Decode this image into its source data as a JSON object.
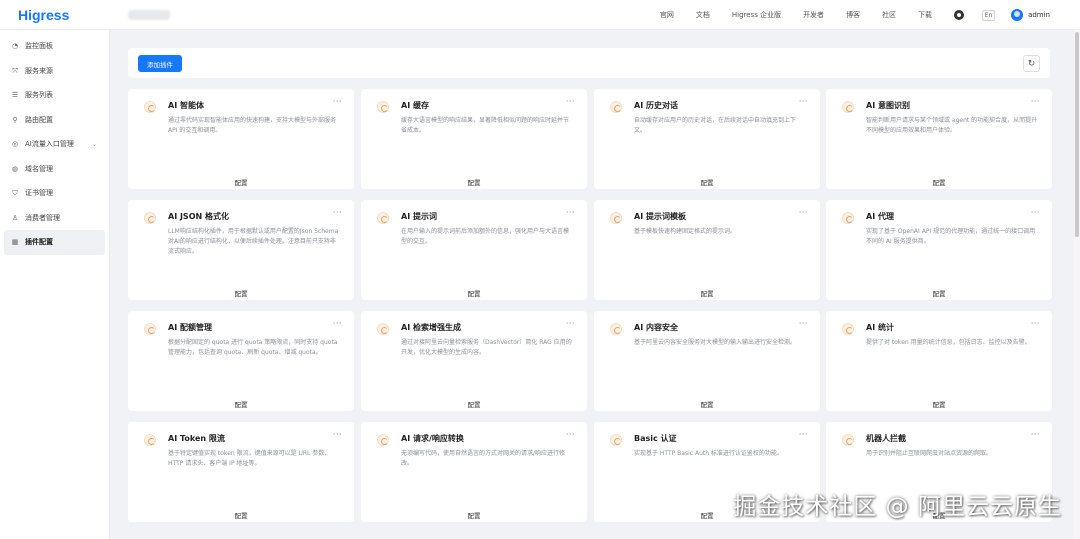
{
  "header": {
    "logo": "Higress",
    "nav": [
      "官网",
      "文档",
      "Higress 企业版",
      "开发者",
      "博客",
      "社区",
      "下载"
    ],
    "lang": "En",
    "user": "admin"
  },
  "sidebar": {
    "items": [
      {
        "label": "监控面板",
        "icon": "dashboard-icon"
      },
      {
        "label": "服务来源",
        "icon": "source-icon"
      },
      {
        "label": "服务列表",
        "icon": "list-icon"
      },
      {
        "label": "路由配置",
        "icon": "route-icon"
      },
      {
        "label": "AI流量入口管理",
        "icon": "ai-gateway-icon",
        "has_children": true
      },
      {
        "label": "域名管理",
        "icon": "globe-icon"
      },
      {
        "label": "证书管理",
        "icon": "certificate-icon"
      },
      {
        "label": "消费者管理",
        "icon": "user-icon"
      },
      {
        "label": "插件配置",
        "icon": "plugin-icon",
        "active": true
      }
    ]
  },
  "toolbar": {
    "add_label": "添加插件"
  },
  "card_action": "配置",
  "cards": [
    {
      "title": "AI 智能体",
      "desc": "通过零代码实现智能体应用的快速构建，支持大模型与外部服务 API 的交互和调用。"
    },
    {
      "title": "AI 缓存",
      "desc": "缓存大语言模型的响应结果，显著降低相似问题的响应时延并节省成本。"
    },
    {
      "title": "AI 历史对话",
      "desc": "自动缓存对应用户的历史对话，在后续对话中自动填充到上下文。"
    },
    {
      "title": "AI 意图识别",
      "desc": "智能判断用户请求与某个领域或 agent 的功能契合度，从而提升不同模型的应用效果和用户体验。"
    },
    {
      "title": "AI JSON 格式化",
      "desc": "LLM响应结构化插件，用于根据默认或用户配置的Json Schema对AI的响应进行结构化，以便后续插件处理。注意目前只支持非流式响应。"
    },
    {
      "title": "AI 提示词",
      "desc": "在用户输入的提示词前后添加额外的信息，强化用户与大语言模型的交互。"
    },
    {
      "title": "AI 提示词模板",
      "desc": "基于模板快速构建固定格式的提示词。"
    },
    {
      "title": "AI 代理",
      "desc": "实现了基于 OpenAI API 规范的代理功能，通过统一的接口调用不同的 AI 服务提供商。"
    },
    {
      "title": "AI 配额管理",
      "desc": "根据分配固定的 quota 进行 quota 策略限流，同时支持 quota 管理能力，包括查询 quota、刷新 quota、增减 quota。"
    },
    {
      "title": "AI 检索增强生成",
      "desc": "通过对接阿里云向量检索服务（DashVector）简化 RAG 应用的开发，优化大模型的生成内容。"
    },
    {
      "title": "AI 内容安全",
      "desc": "基于阿里云内容安全服务对大模型的输入输出进行安全检测。"
    },
    {
      "title": "AI 统计",
      "desc": "提供了对 token 用量的统计信息，包括日志、监控以及告警。"
    },
    {
      "title": "AI Token 限流",
      "desc": "基于特定键值实现 token 限流，键值来源可以是 URL 参数、HTTP 请求头、客户端 IP 地址等。"
    },
    {
      "title": "AI 请求/响应转换",
      "desc": "无须编写代码，使用自然语言的方式对网关的请求/响应进行修改。"
    },
    {
      "title": "Basic 认证",
      "desc": "实现基于 HTTP Basic Auth 标准进行认证鉴权的功能。"
    },
    {
      "title": "机器人拦截",
      "desc": "用于识别并阻止互联网爬虫对站点资源的爬取。"
    }
  ],
  "watermark": "掘金技术社区 @ 阿里云云原生"
}
